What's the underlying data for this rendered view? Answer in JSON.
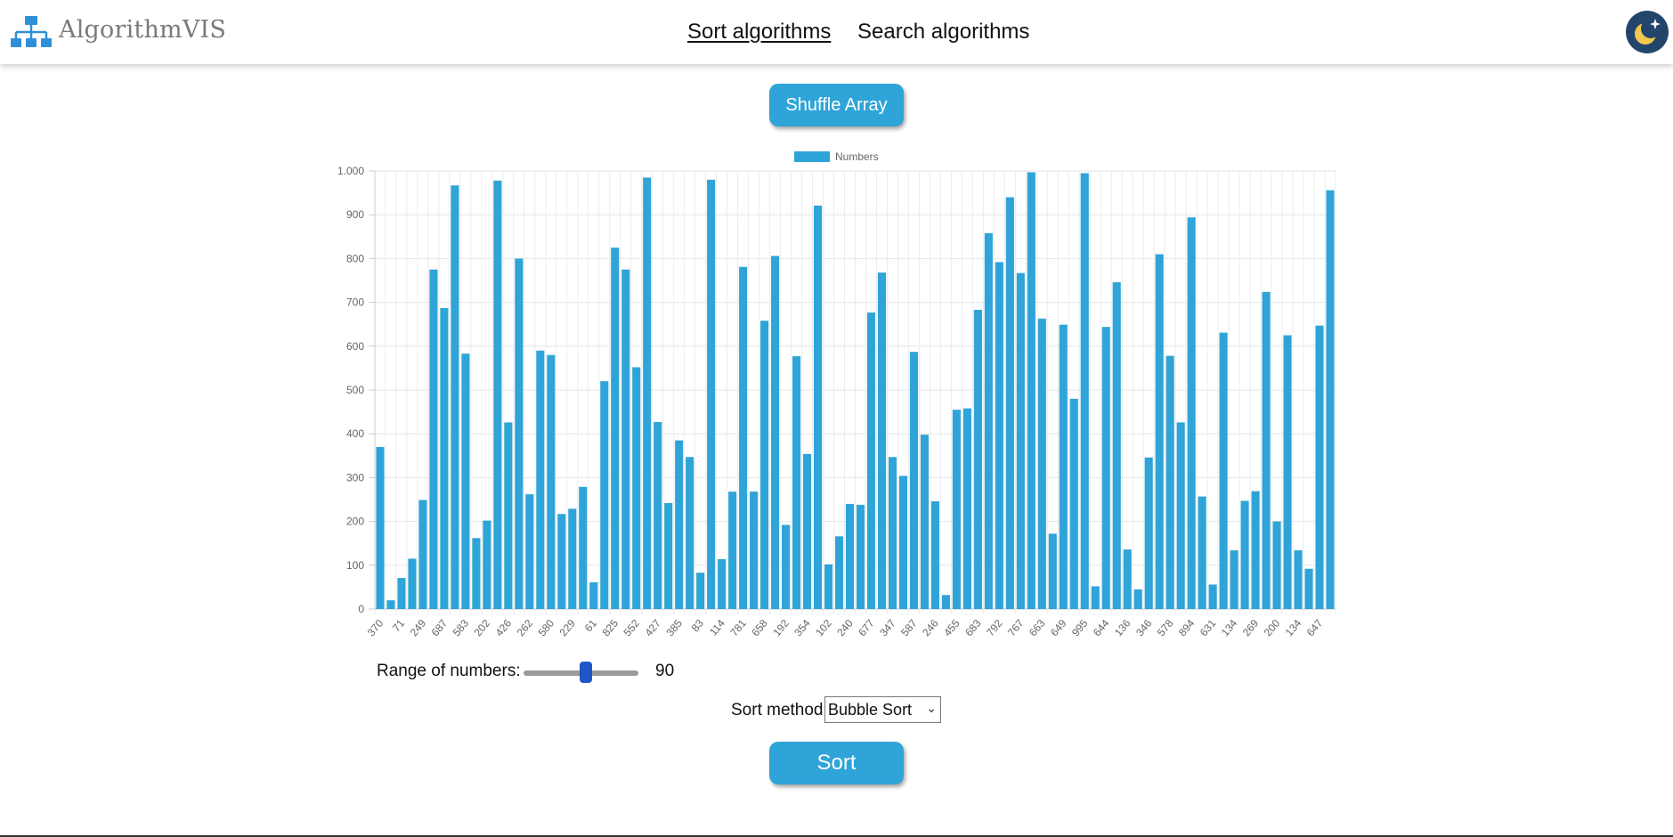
{
  "header": {
    "brand": "AlgorithmVIS",
    "nav": [
      "Sort algorithms",
      "Search algorithms"
    ],
    "active_nav": "Sort algorithms",
    "theme_icon": "moon-star-icon"
  },
  "controls": {
    "shuffle_label": "Shuffle Array",
    "range_label": "Range of numbers:",
    "range_value": "90",
    "sort_method_label": "Sort method:",
    "sort_method_selected": "Bubble Sort",
    "sort_label": "Sort"
  },
  "colors": {
    "accent": "#2fa4d8",
    "slider_thumb": "#2155c7",
    "theme_bg": "#24456b"
  },
  "chart_data": {
    "type": "bar",
    "legend": "Numbers",
    "legend_position": "top",
    "ylim": [
      0,
      1000
    ],
    "yticks": [
      "0",
      "100",
      "200",
      "300",
      "400",
      "500",
      "600",
      "700",
      "800",
      "900",
      "1.000"
    ],
    "grid": true,
    "xtick_labels": [
      "370",
      "71",
      "249",
      "687",
      "583",
      "202",
      "426",
      "262",
      "580",
      "229",
      "61",
      "825",
      "552",
      "427",
      "385",
      "83",
      "114",
      "781",
      "658",
      "192",
      "354",
      "102",
      "240",
      "677",
      "347",
      "587",
      "246",
      "455",
      "683",
      "792",
      "767",
      "663",
      "649",
      "995",
      "644",
      "136",
      "346",
      "578",
      "894",
      "631",
      "134",
      "269",
      "200",
      "134",
      "647"
    ],
    "values": [
      370,
      20,
      71,
      115,
      249,
      775,
      687,
      967,
      583,
      162,
      202,
      978,
      426,
      800,
      262,
      590,
      580,
      217,
      229,
      279,
      61,
      520,
      825,
      775,
      552,
      985,
      427,
      242,
      385,
      347,
      83,
      980,
      114,
      268,
      781,
      268,
      658,
      806,
      192,
      577,
      354,
      921,
      102,
      166,
      240,
      238,
      677,
      768,
      347,
      304,
      587,
      398,
      246,
      32,
      455,
      458,
      683,
      858,
      792,
      940,
      767,
      997,
      663,
      172,
      649,
      480,
      995,
      52,
      644,
      746,
      136,
      45,
      346,
      810,
      578,
      426,
      894,
      257,
      56,
      631,
      134,
      247,
      269,
      724,
      200,
      625,
      134,
      92,
      647,
      956
    ]
  }
}
